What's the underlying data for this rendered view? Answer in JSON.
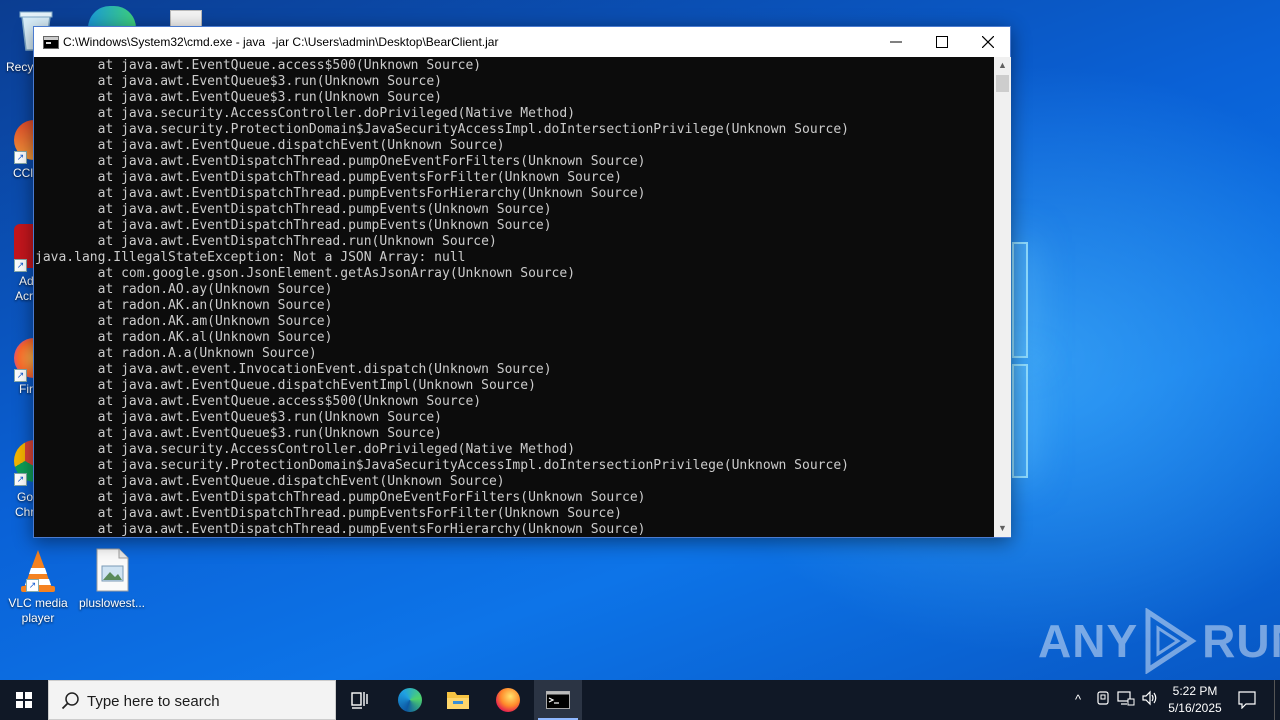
{
  "window": {
    "title": "C:\\Windows\\System32\\cmd.exe - java  -jar C:\\Users\\admin\\Desktop\\BearClient.jar",
    "minimize_symbol": "—",
    "maximize_symbol": "☐",
    "close_symbol": "✕"
  },
  "console_lines": [
    "        at java.awt.EventQueue.access$500(Unknown Source)",
    "        at java.awt.EventQueue$3.run(Unknown Source)",
    "        at java.awt.EventQueue$3.run(Unknown Source)",
    "        at java.security.AccessController.doPrivileged(Native Method)",
    "        at java.security.ProtectionDomain$JavaSecurityAccessImpl.doIntersectionPrivilege(Unknown Source)",
    "        at java.awt.EventQueue.dispatchEvent(Unknown Source)",
    "        at java.awt.EventDispatchThread.pumpOneEventForFilters(Unknown Source)",
    "        at java.awt.EventDispatchThread.pumpEventsForFilter(Unknown Source)",
    "        at java.awt.EventDispatchThread.pumpEventsForHierarchy(Unknown Source)",
    "        at java.awt.EventDispatchThread.pumpEvents(Unknown Source)",
    "        at java.awt.EventDispatchThread.pumpEvents(Unknown Source)",
    "        at java.awt.EventDispatchThread.run(Unknown Source)",
    "java.lang.IllegalStateException: Not a JSON Array: null",
    "        at com.google.gson.JsonElement.getAsJsonArray(Unknown Source)",
    "        at radon.AO.ay(Unknown Source)",
    "        at radon.AK.an(Unknown Source)",
    "        at radon.AK.am(Unknown Source)",
    "        at radon.AK.al(Unknown Source)",
    "        at radon.A.a(Unknown Source)",
    "        at java.awt.event.InvocationEvent.dispatch(Unknown Source)",
    "        at java.awt.EventQueue.dispatchEventImpl(Unknown Source)",
    "        at java.awt.EventQueue.access$500(Unknown Source)",
    "        at java.awt.EventQueue$3.run(Unknown Source)",
    "        at java.awt.EventQueue$3.run(Unknown Source)",
    "        at java.security.AccessController.doPrivileged(Native Method)",
    "        at java.security.ProtectionDomain$JavaSecurityAccessImpl.doIntersectionPrivilege(Unknown Source)",
    "        at java.awt.EventQueue.dispatchEvent(Unknown Source)",
    "        at java.awt.EventDispatchThread.pumpOneEventForFilters(Unknown Source)",
    "        at java.awt.EventDispatchThread.pumpEventsForFilter(Unknown Source)",
    "        at java.awt.EventDispatchThread.pumpEventsForHierarchy(Unknown Source)"
  ],
  "desktop": {
    "partial_labels": [
      "Recy",
      "CCl",
      "Ad",
      "Acr",
      "Fir",
      "Go",
      "Chr"
    ],
    "icons": [
      {
        "label": "VLC media player",
        "icon": "vlc-icon"
      },
      {
        "label": "pluslowest...",
        "icon": "image-file-icon"
      }
    ]
  },
  "watermark": {
    "left": "ANY",
    "right": "RUN"
  },
  "taskbar": {
    "search_placeholder": "Type here to search",
    "items": [
      "task-view-icon",
      "edge-icon",
      "file-explorer-icon",
      "firefox-icon",
      "cmd-icon"
    ],
    "tray": {
      "chevron": "^",
      "time": "5:22 PM",
      "date": "5/16/2025"
    }
  },
  "colors": {
    "console_bg": "#0c0c0c",
    "console_fg": "#cccccc",
    "taskbar_bg": "#101826",
    "wallpaper": "#0a61d6"
  }
}
